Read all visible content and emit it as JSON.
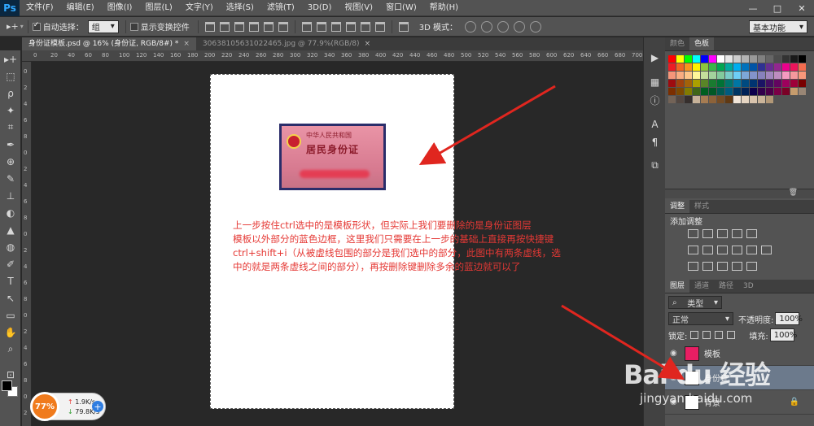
{
  "menubar": {
    "logo": "Ps",
    "items": [
      "文件(F)",
      "编辑(E)",
      "图像(I)",
      "图层(L)",
      "文字(Y)",
      "选择(S)",
      "滤镜(T)",
      "3D(D)",
      "视图(V)",
      "窗口(W)",
      "帮助(H)"
    ],
    "window_controls": [
      "—",
      "□",
      "✕"
    ]
  },
  "options": {
    "auto_select_label": "自动选择：",
    "auto_select_value": "组",
    "show_transform_label": "显示变换控件",
    "mode3d_label": "3D 模式：",
    "workspace": "基本功能"
  },
  "tabs": [
    {
      "label": "身份证模板.psd @ 16% (身份证, RGB/8#) *",
      "close": "×"
    },
    {
      "label": "30638105631022465.jpg @ 77.9%(RGB/8)",
      "close": "×"
    }
  ],
  "rulers": {
    "top": [
      "0",
      "20",
      "40",
      "60",
      "80",
      "100",
      "120",
      "140",
      "160",
      "180",
      "200",
      "220",
      "240",
      "260",
      "280",
      "300",
      "320",
      "340",
      "360",
      "380",
      "400",
      "420",
      "440",
      "460",
      "480",
      "500",
      "520",
      "540",
      "560",
      "580",
      "600",
      "620",
      "640",
      "660",
      "680",
      "700"
    ],
    "left": [
      "0",
      "2",
      "4",
      "6",
      "8",
      "0",
      "2",
      "4",
      "6",
      "8",
      "0",
      "2",
      "4",
      "6",
      "8",
      "0",
      "2",
      "4",
      "6",
      "8",
      "0",
      "2"
    ]
  },
  "tools": [
    "▸+",
    "⬚",
    "ρ",
    "✦",
    "⌗",
    "✒",
    "⊕",
    "✎",
    "⊥",
    "◐",
    "▲",
    "◍",
    "✐",
    "T",
    "↖",
    "▭",
    "✋",
    "⌕",
    "⊡"
  ],
  "idcard": {
    "line1": "中华人民共和国",
    "line2": "居民身份证"
  },
  "note": {
    "line1": "上一步按住ctrl选中的是模板形状，但实际上我们要删除的是身份证图层",
    "line2": "模板以外部分的蓝色边框，这里我们只需要在上一步的基础上直接再按快捷键",
    "line3": "ctrl+shift+i（从被虚线包围的部分是我们选中的部分，此图中有两条虚线，选",
    "line4": "中的就是两条虚线之间的部分），再按删除键删除多余的蓝边就可以了"
  },
  "netspeed": {
    "percent": "77%",
    "up": "1.9K/s",
    "down": "79.8K/s",
    "plus": "+"
  },
  "right_strip": [
    "▶",
    "▦",
    "ⓘ",
    "A",
    "¶",
    "⧉"
  ],
  "color_panel": {
    "tabs": [
      "颜色",
      "色板"
    ]
  },
  "adjust_panel": {
    "tabs": [
      "调整",
      "样式"
    ],
    "title": "添加调整"
  },
  "layers_panel": {
    "tabs": [
      "图层",
      "通道",
      "路径",
      "3D"
    ],
    "filter": "类型",
    "blend_mode": "正常",
    "opacity_label": "不透明度:",
    "opacity": "100%",
    "lock_label": "锁定:",
    "fill_label": "填充:",
    "fill": "100%",
    "layers": [
      {
        "name": "模板",
        "selected": false
      },
      {
        "name": "身份证",
        "selected": true
      },
      {
        "name": "背景",
        "selected": false
      }
    ]
  },
  "watermark": {
    "brand": "Bai du 经验",
    "url": "jingyan.baidu.com"
  },
  "colors": {
    "note_red": "#e53935",
    "ui_bg": "#535353",
    "canvas_bg": "#282828",
    "arrow_red": "#e0261f"
  }
}
